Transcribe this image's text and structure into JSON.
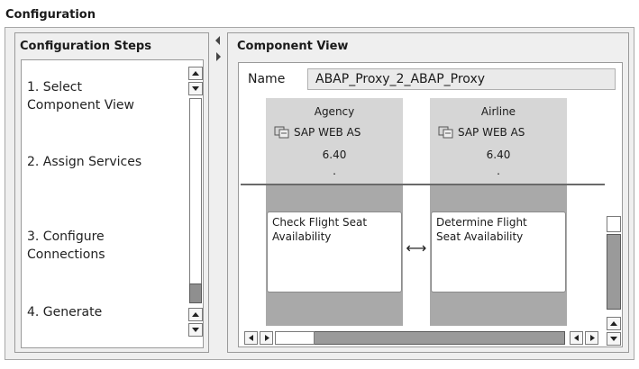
{
  "window": {
    "title": "Configuration"
  },
  "steps_panel": {
    "title": "Configuration Steps",
    "steps": [
      {
        "label_line1": "1. Select",
        "label_line2": "Component View"
      },
      {
        "label_line1": "2. Assign Services"
      },
      {
        "label_line1": "3. Configure",
        "label_line2": "Connections"
      },
      {
        "label_line1": "4. Generate"
      }
    ]
  },
  "component_view": {
    "title": "Component View",
    "name_label": "Name",
    "name_value": "ABAP_Proxy_2_ABAP_Proxy",
    "components": [
      {
        "name": "Agency",
        "system": "SAP WEB AS",
        "version": "6.40",
        "extra": ".",
        "service_line1": "Check Flight Seat",
        "service_line2": "Availability"
      },
      {
        "name": "Airline",
        "system": "SAP WEB AS",
        "version": "6.40",
        "extra": ".",
        "service_line1": "Determine Flight",
        "service_line2": "Seat Availability"
      }
    ],
    "connector_symbol": "⟷"
  },
  "icons": [
    "arrow-up-icon",
    "arrow-down-icon",
    "arrow-left-icon",
    "arrow-right-icon",
    "collapse-left-icon",
    "expand-right-icon",
    "sap-system-icon"
  ]
}
